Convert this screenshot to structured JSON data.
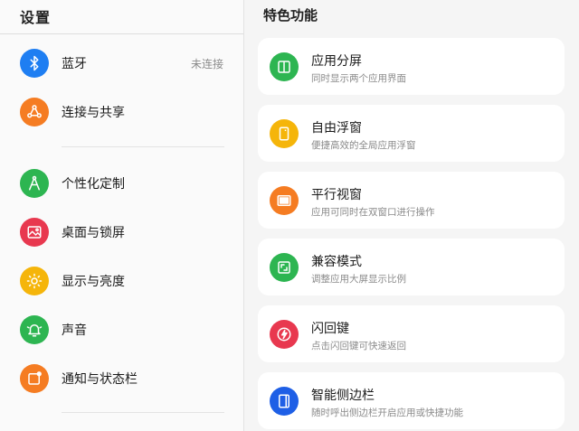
{
  "settings": {
    "title": "设置",
    "items": [
      {
        "label": "蓝牙",
        "status": "未连接",
        "icon": "bluetooth-icon",
        "color": "#1e7ef2"
      },
      {
        "label": "连接与共享",
        "icon": "share-icon",
        "color": "#f57c22"
      },
      {
        "label": "个性化定制",
        "icon": "compass-icon",
        "color": "#2db551"
      },
      {
        "label": "桌面与锁屏",
        "icon": "image-icon",
        "color": "#e8384f"
      },
      {
        "label": "显示与亮度",
        "icon": "sun-icon",
        "color": "#f5b50a"
      },
      {
        "label": "声音",
        "icon": "bell-icon",
        "color": "#2db551"
      },
      {
        "label": "通知与状态栏",
        "icon": "notification-icon",
        "color": "#f57c22"
      }
    ]
  },
  "features": {
    "title": "特色功能",
    "cards": [
      {
        "title": "应用分屏",
        "desc": "同时显示两个应用界面",
        "icon": "split-screen-icon",
        "color": "#2db551"
      },
      {
        "title": "自由浮窗",
        "desc": "便捷高效的全局应用浮窗",
        "icon": "floating-window-icon",
        "color": "#f5b50a"
      },
      {
        "title": "平行视窗",
        "desc": "应用可同时在双窗口进行操作",
        "icon": "parallel-window-icon",
        "color": "#f57c22"
      },
      {
        "title": "兼容模式",
        "desc": "调整应用大屏显示比例",
        "icon": "compat-mode-icon",
        "color": "#2db551"
      },
      {
        "title": "闪回键",
        "desc": "点击闪回键可快速返回",
        "icon": "flashback-icon",
        "color": "#e8384f"
      },
      {
        "title": "智能侧边栏",
        "desc": "随时呼出侧边栏开启应用或快捷功能",
        "icon": "sidebar-icon",
        "color": "#1e5fe6"
      }
    ]
  }
}
